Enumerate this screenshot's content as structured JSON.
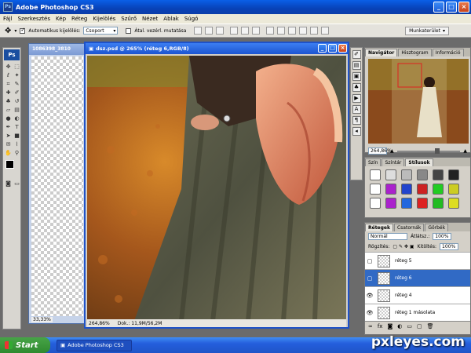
{
  "app": {
    "title": "Adobe Photoshop CS3",
    "logo": "Ps"
  },
  "menu": [
    "Fájl",
    "Szerkesztés",
    "Kép",
    "Réteg",
    "Kijelölés",
    "Szűrő",
    "Nézet",
    "Ablak",
    "Súgó"
  ],
  "options": {
    "auto_select_label": "Automatikus kijelölés:",
    "auto_select_value": "Csoport",
    "transform_label": "Átal. vezérl. mutatása",
    "workspace_label": "Munkaterület"
  },
  "doc_background": {
    "title": "1086398_3810",
    "zoom": "33,33%"
  },
  "document": {
    "title": "dsz.psd @ 265% (réteg 6,RGB/8)",
    "zoom": "264,86%",
    "info": "Dok.: 11,9M/56,2M"
  },
  "navigator": {
    "tabs": [
      "Navigátor",
      "Hisztogram",
      "Információ"
    ],
    "zoom": "264,86%"
  },
  "styles_panel": {
    "tabs": [
      "Szín",
      "Színtár",
      "Stílusok"
    ],
    "swatch_colors": [
      "#ffffff",
      "#dddddd",
      "#bbbbbb",
      "#888888",
      "#444444",
      "#222222",
      "#ffffff",
      "#aa22cc",
      "#2244cc",
      "#cc2222",
      "#22cc22",
      "#cccc22",
      "#ffffff",
      "#aa22cc",
      "#2266dd",
      "#dd2222",
      "#22bb22",
      "#dddd22"
    ]
  },
  "layers": {
    "tabs": [
      "Rétegek",
      "Csatornák",
      "Görbék"
    ],
    "blend_mode": "Normál",
    "opacity_label": "Átlátsz.:",
    "opacity": "100%",
    "lock_label": "Rögzítés:",
    "fill_label": "Kitöltés:",
    "fill": "100%",
    "rows": [
      {
        "name": "réteg 5",
        "visible": false,
        "active": false
      },
      {
        "name": "réteg 6",
        "visible": false,
        "active": true
      },
      {
        "name": "réteg 4",
        "visible": true,
        "active": false
      },
      {
        "name": "réteg 1 másolata",
        "visible": true,
        "active": false
      }
    ]
  },
  "taskbar": {
    "start": "Start",
    "task": "Adobe Photoshop CS3"
  },
  "watermark": "pxleyes.com"
}
